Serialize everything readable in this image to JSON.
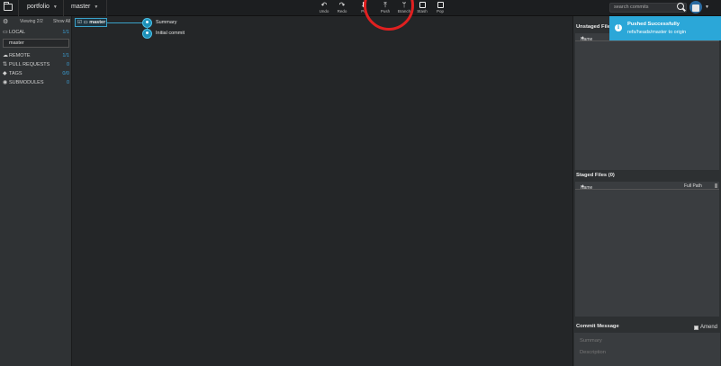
{
  "toolbar": {
    "repo": "portfolio",
    "branch": "master",
    "buttons": [
      {
        "label": "Undo",
        "icon": "undo-icon"
      },
      {
        "label": "Redo",
        "icon": "redo-icon"
      },
      {
        "label": "Pu",
        "icon": "pull-icon"
      },
      {
        "label": "Push",
        "icon": "push-icon"
      },
      {
        "label": "Branch",
        "icon": "branch-icon"
      },
      {
        "label": "Stash",
        "icon": "stash-icon"
      },
      {
        "label": "Pop",
        "icon": "pop-icon"
      }
    ],
    "search_placeholder": "search commits"
  },
  "sidebar": {
    "viewing": "Viewing 2/2",
    "show_all": "Show All",
    "local": {
      "label": "LOCAL",
      "count": "1/1"
    },
    "branch_input": "master",
    "remote": {
      "label": "REMOTE",
      "count": "1/1"
    },
    "pull_requests": {
      "label": "PULL REQUESTS",
      "count": "0"
    },
    "tags": {
      "label": "TAGS",
      "count": "0/0"
    },
    "submodules": {
      "label": "SUBMODULES",
      "count": "0"
    }
  },
  "graph": {
    "branch_label": "master",
    "commits": [
      {
        "message": "Summary"
      },
      {
        "message": "Initial commit"
      }
    ]
  },
  "right_panel": {
    "unstaged_title": "Unstaged File",
    "unstaged_col": "Name",
    "staged_title": "Staged Files (0)",
    "staged_col_name": "Name",
    "staged_col_path": "Full Path",
    "commit_message_title": "Commit Message",
    "amend_label": "Amend",
    "summary_placeholder": "Summary",
    "description_placeholder": "Description"
  },
  "toast": {
    "title": "Pushed Successfully",
    "subtitle": "refs/heads/master to origin",
    "color": "#2ba7d8"
  }
}
